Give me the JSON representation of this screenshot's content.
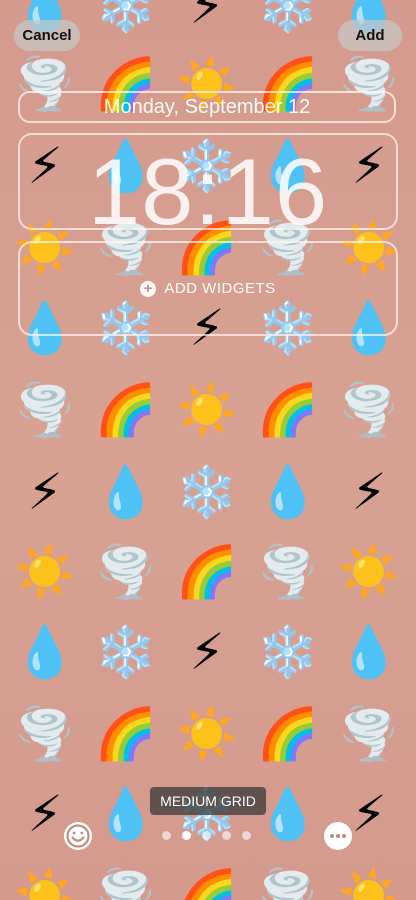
{
  "toolbar": {
    "cancel_label": "Cancel",
    "add_label": "Add"
  },
  "lock_screen": {
    "date": "Monday, September 12",
    "time": "18:16",
    "add_widgets_label": "ADD WIDGETS"
  },
  "wallpaper": {
    "style_label": "MEDIUM GRID",
    "emoji_set": [
      "droplet",
      "snowflake",
      "lightning",
      "sun",
      "tornado",
      "rainbow"
    ],
    "background_color": "#d59b8e",
    "selected_page": 2,
    "page_count": 5
  },
  "icons": {
    "emoji_button": "smiley-icon",
    "more_button": "ellipsis-icon",
    "plus": "plus-circle-icon"
  }
}
